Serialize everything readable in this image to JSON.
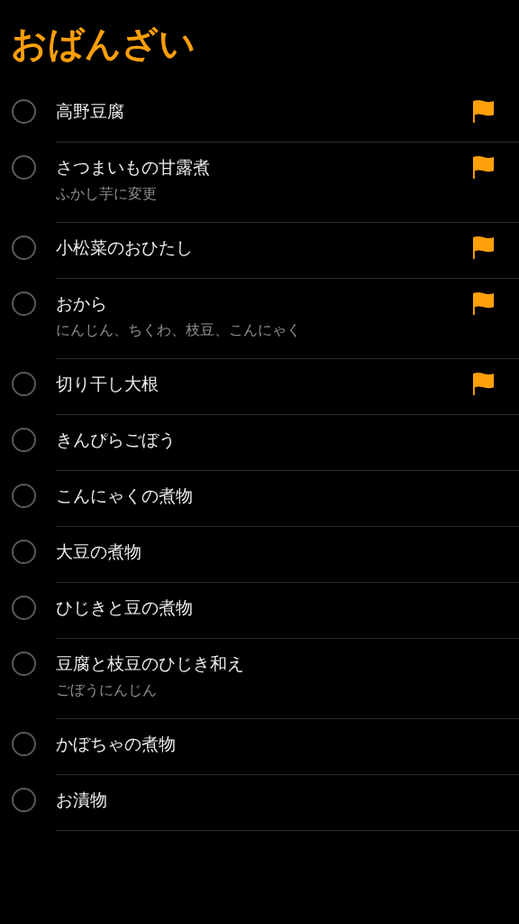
{
  "list_title": "おばんざい",
  "reminders": [
    {
      "title": "高野豆腐",
      "completed": false,
      "flagged": true
    },
    {
      "title": "さつまいもの甘露煮",
      "note": "ふかし芋に変更",
      "completed": false,
      "flagged": true
    },
    {
      "title": "小松菜のおひたし",
      "completed": false,
      "flagged": true
    },
    {
      "title": "おから",
      "note": "にんじん、ちくわ、枝豆、こんにゃく",
      "completed": false,
      "flagged": true
    },
    {
      "title": "切り干し大根",
      "completed": false,
      "flagged": true
    },
    {
      "title": "きんぴらごぼう",
      "completed": false,
      "flagged": false
    },
    {
      "title": "こんにゃくの煮物",
      "completed": false,
      "flagged": false
    },
    {
      "title": "大豆の煮物",
      "completed": false,
      "flagged": false
    },
    {
      "title": "ひじきと豆の煮物",
      "completed": false,
      "flagged": false
    },
    {
      "title": "豆腐と枝豆のひじき和え",
      "note": "ごぼうにんじん",
      "completed": false,
      "flagged": false
    },
    {
      "title": "かぼちゃの煮物",
      "completed": false,
      "flagged": false
    },
    {
      "title": "お漬物",
      "completed": false,
      "flagged": false
    }
  ]
}
